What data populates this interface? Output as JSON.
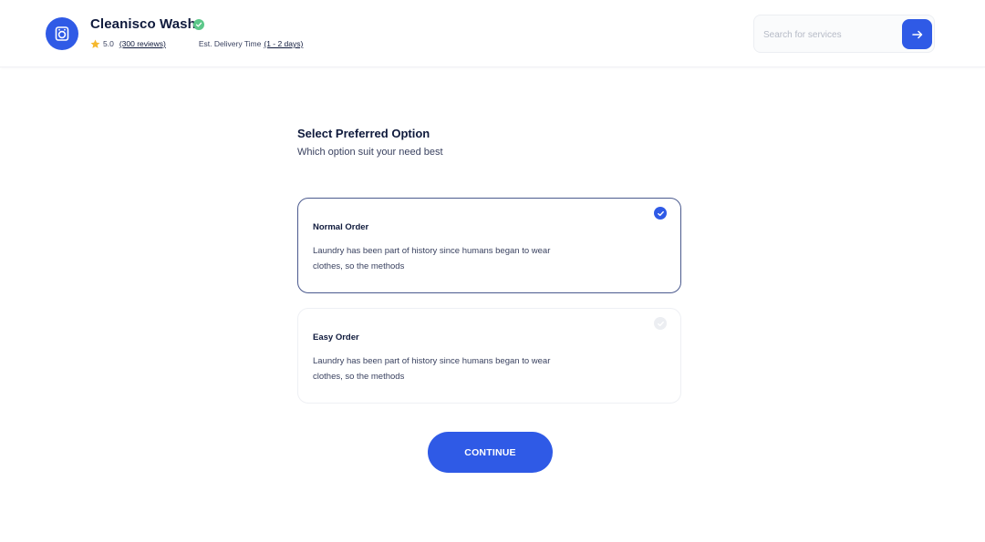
{
  "header": {
    "brand_name": "Cleanisco Wash",
    "logo_icon": "washing-machine-icon",
    "verified_icon": "check-badge-icon",
    "rating": "5.0",
    "reviews": "(300 reviews)",
    "delivery_label": "Est. Delivery Time",
    "delivery_value": "(1 - 2 days)"
  },
  "search": {
    "placeholder": "Search for services",
    "button_icon": "arrow-right-icon"
  },
  "main": {
    "title": "Select Preferred Option",
    "subtitle": "Which option suit your need best",
    "options": [
      {
        "title": "Normal Order",
        "description": "Laundry has been part of history since humans began to wear clothes, so the methods",
        "selected": true
      },
      {
        "title": "Easy Order",
        "description": "Laundry has been part of history since humans began to wear clothes, so the methods",
        "selected": false
      }
    ],
    "continue_label": "CONTINUE"
  },
  "colors": {
    "accent": "#2f5ae6",
    "verified": "#5cc88a",
    "star": "#f5b82e",
    "text": "#0f1a3c"
  }
}
